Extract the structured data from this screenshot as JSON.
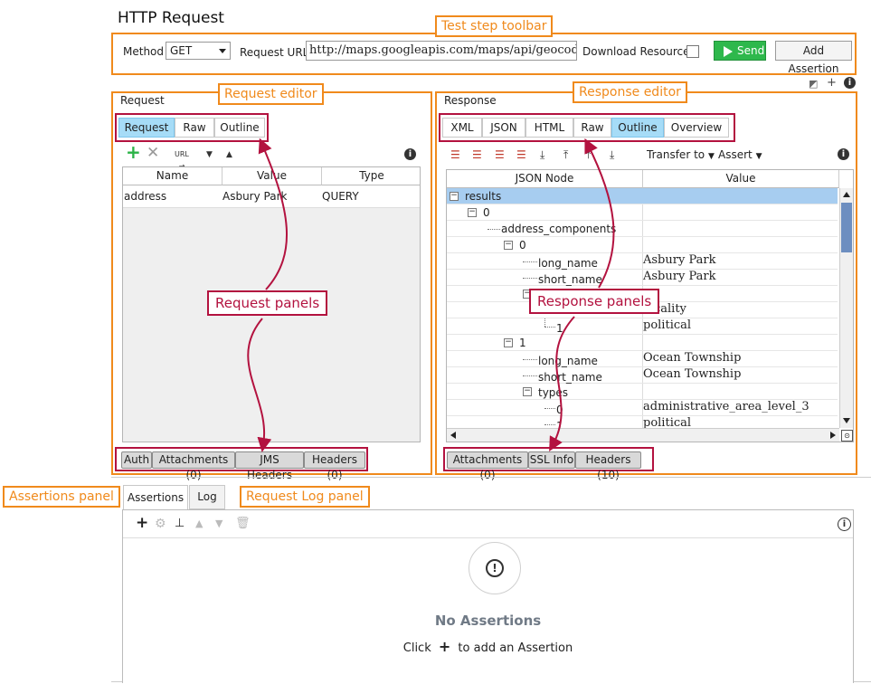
{
  "window": {
    "title": "HTTP Request"
  },
  "annotations": {
    "toolbar": "Test step toolbar",
    "request_editor": "Request editor",
    "response_editor": "Response editor",
    "request_panels": "Request panels",
    "response_panels": "Response panels",
    "assertions_panel": "Assertions panel",
    "request_log_panel": "Request Log panel"
  },
  "toolbar": {
    "method_label": "Method",
    "method_value": "GET",
    "url_label": "Request URL:",
    "url_value": "http://maps.googleapis.com/maps/api/geocode/json",
    "download_label": "Download Resources",
    "send_label": "Send",
    "add_assertion_label": "Add Assertion"
  },
  "request": {
    "header": "Request",
    "tabs": [
      "Request",
      "Raw",
      "Outline"
    ],
    "active_tab": "Request",
    "table": {
      "columns": [
        "Name",
        "Value",
        "Type"
      ],
      "rows": [
        {
          "name": "address",
          "value": "Asbury Park",
          "type": "QUERY"
        }
      ]
    },
    "bottom_tabs": [
      "Auth",
      "Attachments (0)",
      "JMS Headers",
      "Headers (0)"
    ]
  },
  "response": {
    "header": "Response",
    "tabs": [
      "XML",
      "JSON",
      "HTML",
      "Raw",
      "Outline",
      "Overview"
    ],
    "active_tab": "Outline",
    "toolbar": {
      "transfer": "Transfer to",
      "assert": "Assert"
    },
    "tree_columns": [
      "JSON Node",
      "Value"
    ],
    "tree": [
      {
        "node": "results",
        "value": ""
      },
      {
        "node": "0",
        "value": ""
      },
      {
        "node": "address_components",
        "value": ""
      },
      {
        "node": "0",
        "value": ""
      },
      {
        "node": "long_name",
        "value": "Asbury Park"
      },
      {
        "node": "short_name",
        "value": "Asbury Park"
      },
      {
        "node": "",
        "value": ""
      },
      {
        "node": "",
        "value": "locality"
      },
      {
        "node": "1",
        "value": "political"
      },
      {
        "node": "1",
        "value": ""
      },
      {
        "node": "long_name",
        "value": "Ocean Township"
      },
      {
        "node": "short_name",
        "value": "Ocean Township"
      },
      {
        "node": "types",
        "value": ""
      },
      {
        "node": "0",
        "value": "administrative_area_level_3"
      },
      {
        "node": "1",
        "value": "political"
      }
    ],
    "bottom_tabs": [
      "Attachments (0)",
      "SSL Info",
      "Headers (10)"
    ]
  },
  "assertions": {
    "tabs": [
      "Assertions",
      "Log"
    ],
    "active_tab": "Assertions",
    "empty_title": "No Assertions",
    "hint_prefix": "Click",
    "hint_suffix": "to add an Assertion"
  },
  "colors": {
    "annotation_orange": "#f08a1c",
    "annotation_red": "#b3123f",
    "active_tab": "#a6dcf7",
    "send_green": "#2eb84c",
    "tree_selection": "#a7cdf0"
  }
}
